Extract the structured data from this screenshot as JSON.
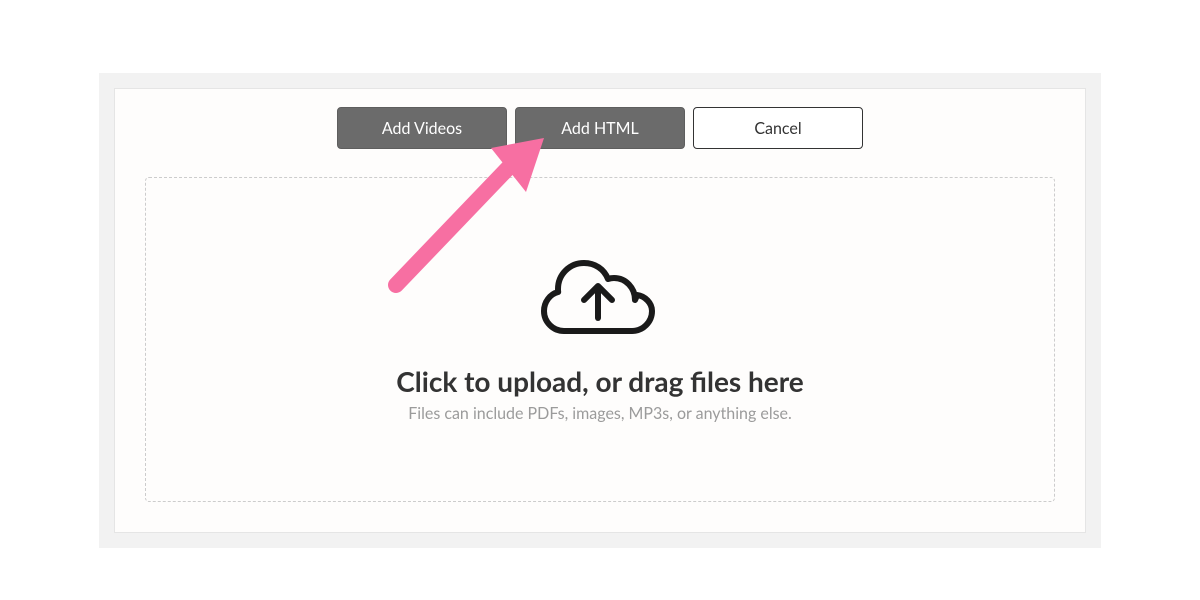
{
  "buttons": {
    "add_videos": "Add Videos",
    "add_html": "Add HTML",
    "cancel": "Cancel"
  },
  "dropzone": {
    "heading": "Click to upload, or drag files here",
    "subtext": "Files can include PDFs, images, MP3s, or anything else."
  },
  "colors": {
    "button_dark_bg": "#6b6b6b",
    "arrow": "#f76fa2"
  }
}
